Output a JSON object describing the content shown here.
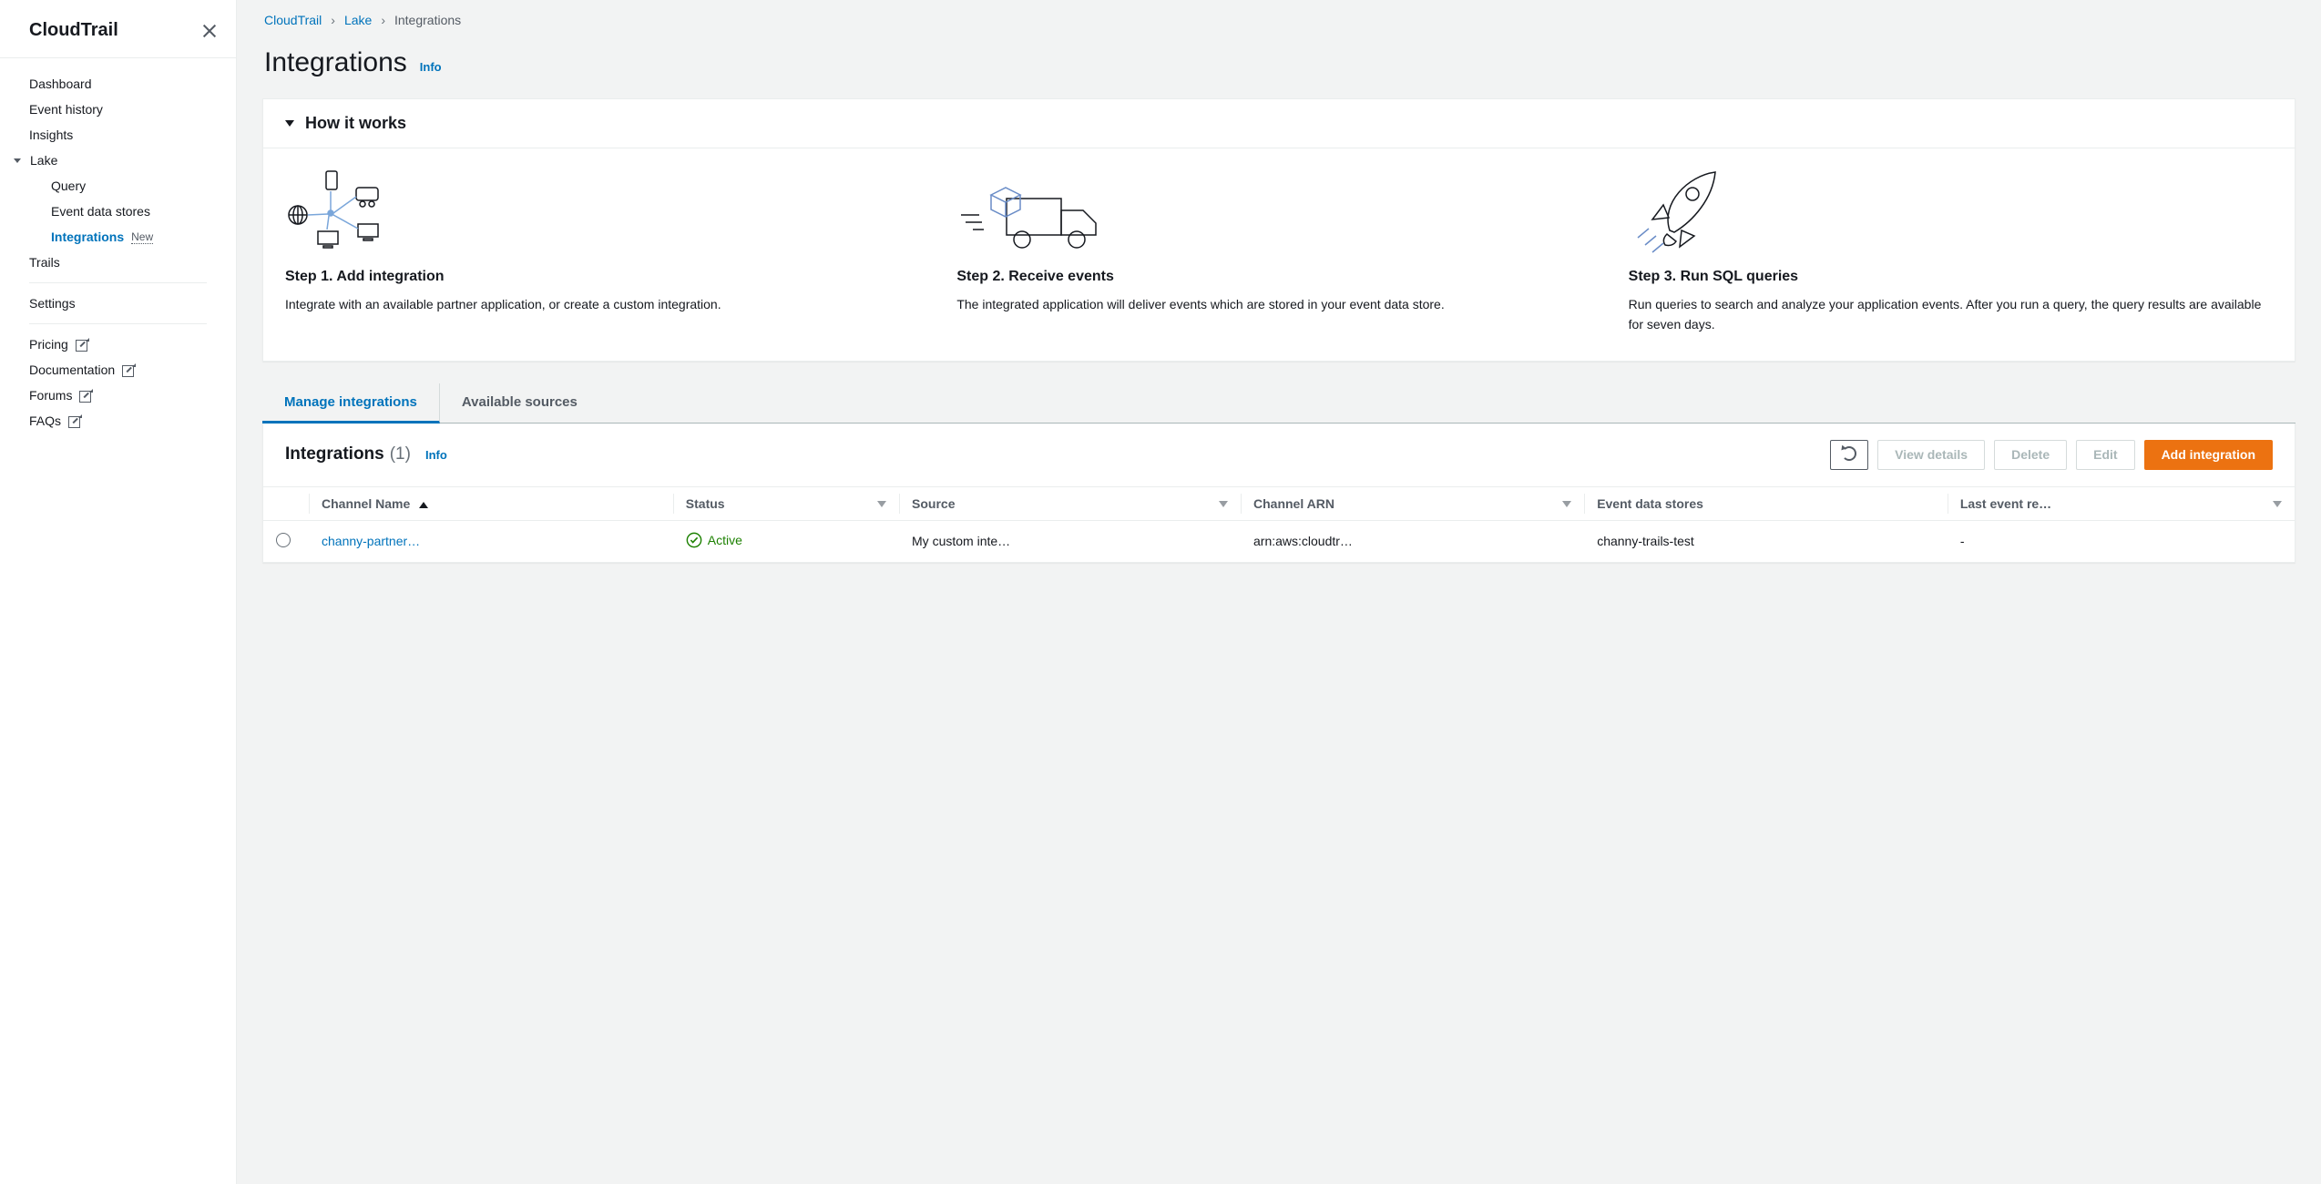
{
  "sidebar": {
    "title": "CloudTrail",
    "items": {
      "dashboard": "Dashboard",
      "event_history": "Event history",
      "insights": "Insights",
      "lake": "Lake",
      "query": "Query",
      "event_data_stores": "Event data stores",
      "integrations": "Integrations",
      "trails": "Trails",
      "settings": "Settings",
      "pricing": "Pricing",
      "documentation": "Documentation",
      "forums": "Forums",
      "faqs": "FAQs"
    },
    "new_tag": "New"
  },
  "breadcrumbs": {
    "a": "CloudTrail",
    "b": "Lake",
    "c": "Integrations"
  },
  "page_title": "Integrations",
  "info_label": "Info",
  "how_it_works": {
    "title": "How it works",
    "step1": {
      "title": "Step 1. Add integration",
      "body": "Integrate with an available partner application, or create a custom integration."
    },
    "step2": {
      "title": "Step 2. Receive events",
      "body": "The integrated application will deliver events which are stored in your event data store."
    },
    "step3": {
      "title": "Step 3. Run SQL queries",
      "body": "Run queries to search and analyze your application events. After you run a query, the query results are available for seven days."
    }
  },
  "tabs": {
    "manage": "Manage integrations",
    "sources": "Available sources"
  },
  "integrations_panel": {
    "title": "Integrations",
    "count": "(1)",
    "buttons": {
      "view_details": "View details",
      "delete": "Delete",
      "edit": "Edit",
      "add": "Add integration"
    },
    "columns": {
      "channel_name": "Channel Name",
      "status": "Status",
      "source": "Source",
      "channel_arn": "Channel ARN",
      "event_data_stores": "Event data stores",
      "last_event": "Last event re…"
    },
    "rows": [
      {
        "channel_name": "channy-partner…",
        "status": "Active",
        "source": "My custom inte…",
        "channel_arn": "arn:aws:cloudtr…",
        "event_data_stores": "channy-trails-test",
        "last_event": "-"
      }
    ]
  }
}
